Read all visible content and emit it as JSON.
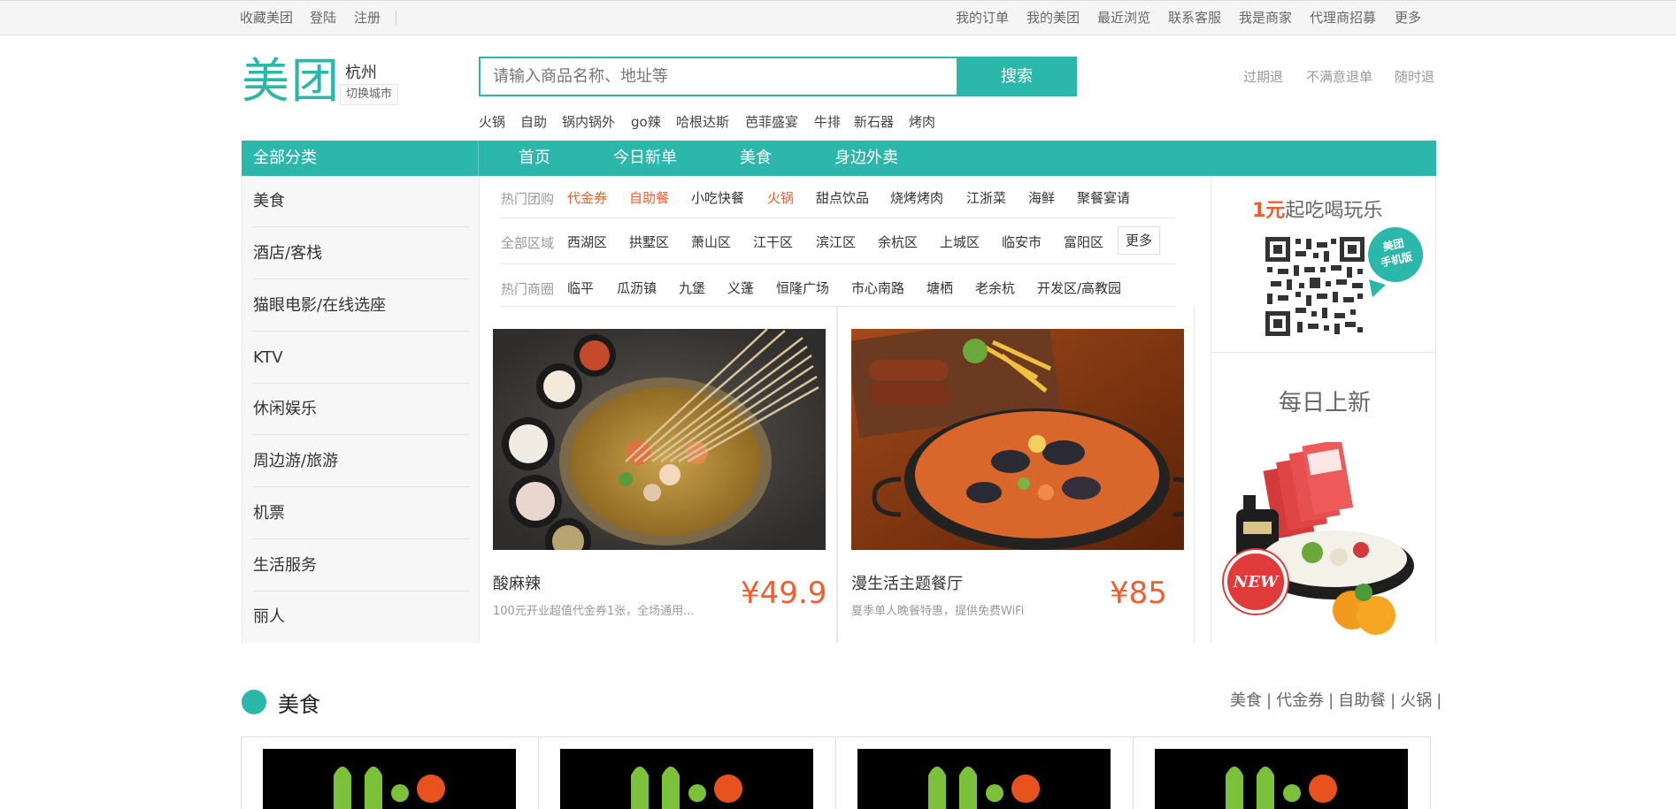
{
  "topbar": {
    "left_links": [
      "收藏美团",
      "登陆",
      "注册"
    ],
    "right_links": [
      "我的订单",
      "我的美团",
      "最近浏览",
      "联系客服",
      "我是商家",
      "代理商招募",
      "更多"
    ]
  },
  "header": {
    "logo": "美团",
    "city": "杭州",
    "switch_city": "切换城市",
    "search_placeholder": "请输入商品名称、地址等",
    "search_button": "搜索",
    "hot_words": [
      "火锅",
      "自助",
      "锅内锅外",
      "go辣",
      "哈根达斯",
      "芭菲盛宴",
      "牛排",
      "新石器",
      "烤肉"
    ],
    "promises": [
      "过期退",
      "不满意退单",
      "随时退"
    ]
  },
  "nav": {
    "all_categories": "全部分类",
    "items": [
      "首页",
      "今日新单",
      "美食",
      "身边外卖"
    ]
  },
  "sidebar": {
    "items": [
      "美食",
      "酒店/客栈",
      "猫眼电影/在线选座",
      "KTV",
      "休闲娱乐",
      "周边游/旅游",
      "机票",
      "生活服务",
      "丽人"
    ]
  },
  "filters": {
    "hot_group": {
      "label": "热门团购",
      "items": [
        {
          "text": "代金券",
          "hot": true
        },
        {
          "text": "自助餐",
          "hot": true
        },
        {
          "text": "小吃快餐",
          "hot": false
        },
        {
          "text": "火锅",
          "hot": true
        },
        {
          "text": "甜点饮品",
          "hot": false
        },
        {
          "text": "烧烤烤肉",
          "hot": false
        },
        {
          "text": "江浙菜",
          "hot": false
        },
        {
          "text": "海鲜",
          "hot": false
        },
        {
          "text": "聚餐宴请",
          "hot": false
        }
      ]
    },
    "areas": {
      "label": "全部区域",
      "items": [
        "西湖区",
        "拱墅区",
        "萧山区",
        "江干区",
        "滨江区",
        "余杭区",
        "上城区",
        "临安市",
        "富阳区"
      ],
      "more": "更多"
    },
    "districts": {
      "label": "热门商圈",
      "items": [
        "临平",
        "瓜沥镇",
        "九堡",
        "义蓬",
        "恒隆广场",
        "市心南路",
        "塘栖",
        "老余杭",
        "开发区/高教园"
      ]
    }
  },
  "deals": [
    {
      "title": "酸麻辣",
      "desc": "100元开业超值代金券1张，全场通用...",
      "price": "¥49.9"
    },
    {
      "title": "漫生活主题餐厅",
      "desc": "夏季单人晚餐特惠，提供免费WiFi",
      "price": "¥85"
    }
  ],
  "right": {
    "promo_num": "1元",
    "promo_rest": "起吃喝玩乐",
    "badge": "美团手机版",
    "badge_line1": "美团",
    "badge_line2": "手机版",
    "daily": "每日上新",
    "new_tag": "NEW"
  },
  "section": {
    "title": "美食",
    "links": [
      "美食",
      "代金券",
      "自助餐",
      "火锅"
    ]
  },
  "colors": {
    "brand": "#2bb8aa",
    "price": "#f45c2c"
  }
}
